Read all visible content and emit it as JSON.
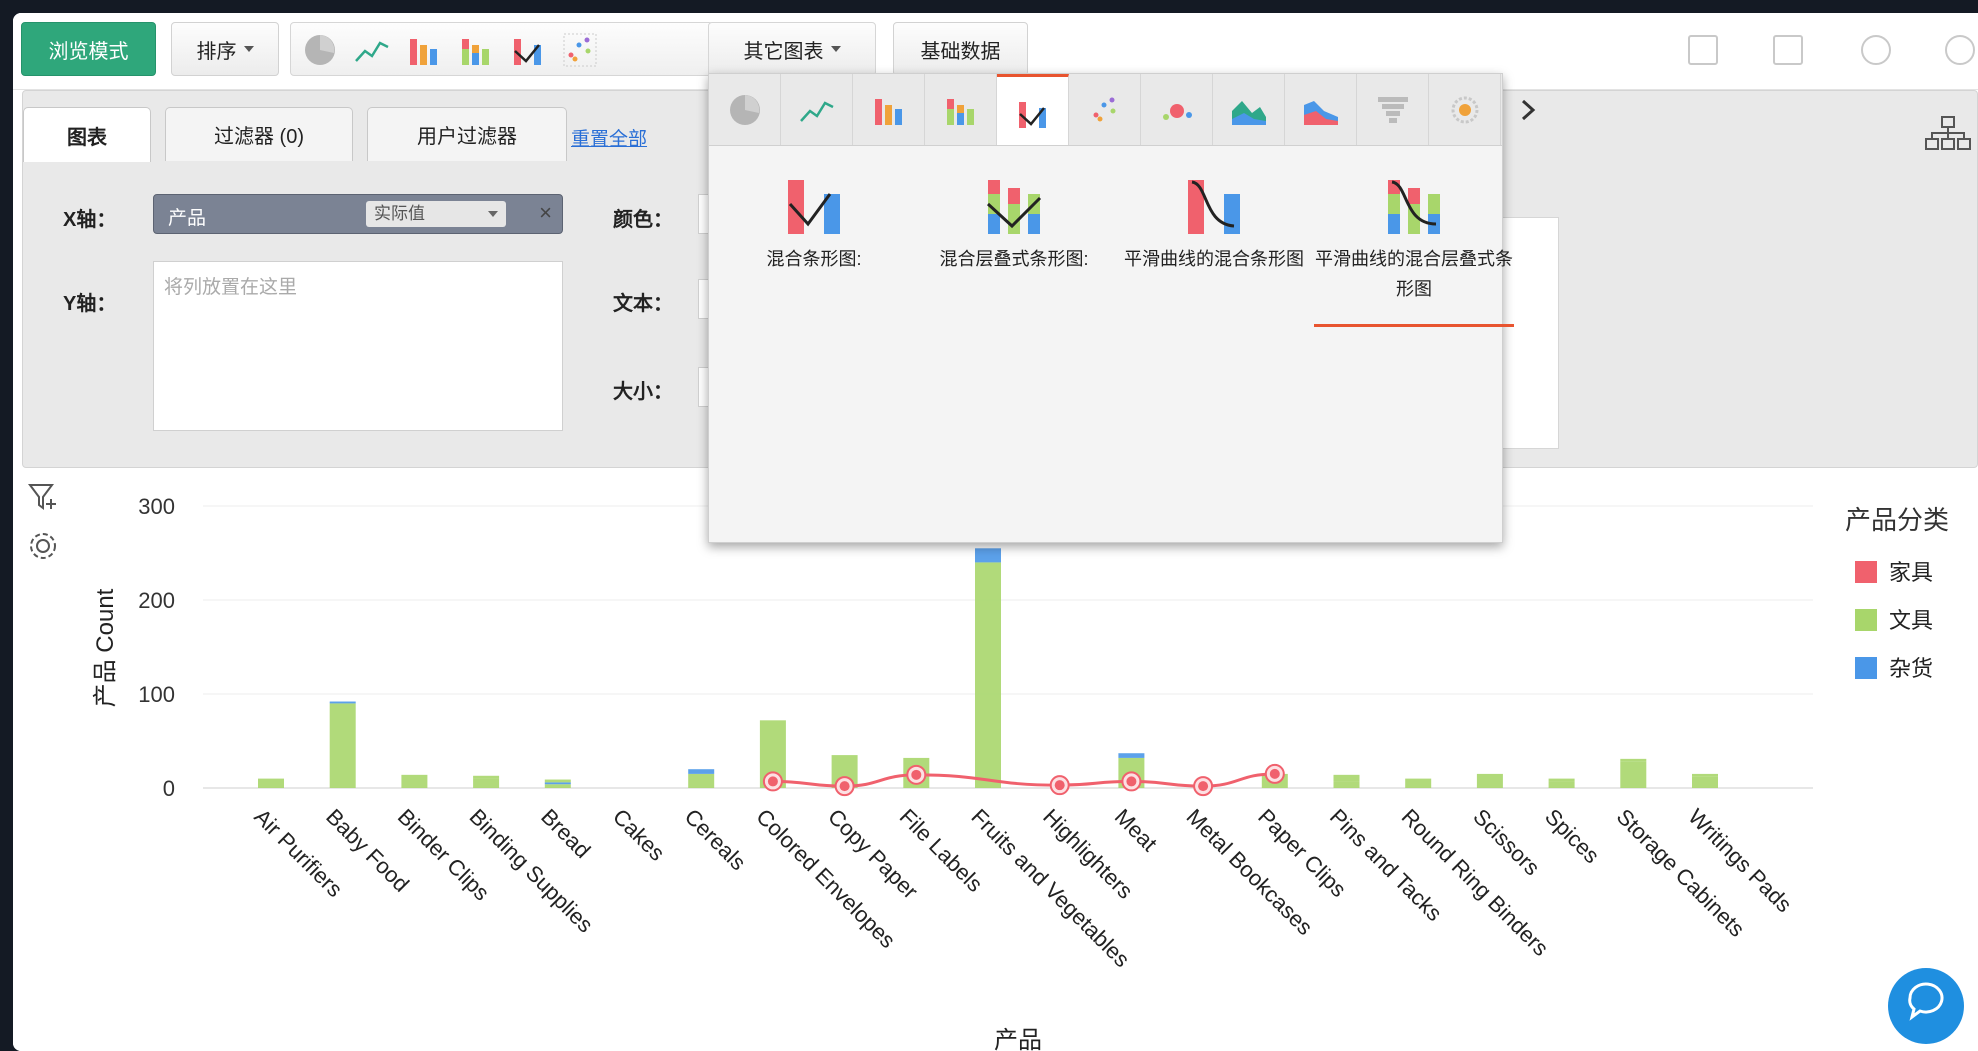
{
  "toolbar": {
    "browse_mode": "浏览模式",
    "sort": "排序",
    "other_charts": "其它图表",
    "base_data": "基础数据"
  },
  "config": {
    "tabs": [
      "图表",
      "过滤器 (0)",
      "用户过滤器"
    ],
    "reset_all": "重置全部",
    "x_axis_label": "X轴：",
    "x_field": "产品",
    "x_aggregation": "实际值",
    "y_axis_label": "Y轴：",
    "y_placeholder": "将列放置在这里",
    "color_label": "颜色：",
    "text_label": "文本：",
    "size_label": "大小："
  },
  "dropdown": {
    "chart_types": [
      "混合条形图:",
      "混合层叠式条形图:",
      "平滑曲线的混合条形图",
      "平滑曲线的混合层叠式条形图"
    ],
    "selected_index": 3
  },
  "legend": {
    "title": "产品分类",
    "items": [
      {
        "label": "家具",
        "color": "#f0616d"
      },
      {
        "label": "文具",
        "color": "#a8d66b"
      },
      {
        "label": "杂货",
        "color": "#4a97e8"
      }
    ]
  },
  "chart_data": {
    "type": "bar",
    "categories": [
      "Air Purifiers",
      "Baby Food",
      "Binder Clips",
      "Binding Supplies",
      "Bread",
      "Cakes",
      "Cereals",
      "Colored Envelopes",
      "Copy Paper",
      "File Labels",
      "Fruits and Vegetables",
      "Highlighters",
      "Meat",
      "Metal Bookcases",
      "Paper Clips",
      "Pins and Tacks",
      "Round Ring Binders",
      "Scissors",
      "Spices",
      "Storage Cabinets",
      "Writings Pads"
    ],
    "xlabel": "产品",
    "ylabel": "产品 Count",
    "ylim": [
      0,
      300
    ],
    "yticks": [
      0,
      100,
      200,
      300
    ],
    "bars": [
      {
        "group": "文具",
        "values": [
          10,
          90,
          14,
          10,
          4,
          0,
          15,
          72,
          35,
          32,
          240,
          0,
          32,
          0,
          15,
          7,
          10,
          15,
          7,
          28,
          12
        ]
      },
      {
        "group": "杂货",
        "values": [
          0,
          2,
          0,
          0,
          2,
          0,
          5,
          0,
          0,
          0,
          15,
          0,
          5,
          0,
          0,
          0,
          0,
          0,
          0,
          0,
          0
        ]
      },
      {
        "group": "文具",
        "values": [
          0,
          0,
          0,
          3,
          3,
          0,
          0,
          0,
          0,
          0,
          0,
          0,
          0,
          0,
          0,
          7,
          0,
          0,
          3,
          3,
          3
        ]
      }
    ],
    "line": {
      "name": "家具",
      "points": [
        {
          "category": "Colored Envelopes",
          "value": 7
        },
        {
          "category": "Copy Paper",
          "value": 2
        },
        {
          "category": "File Labels",
          "value": 14
        },
        {
          "category": "Highlighters",
          "value": 3
        },
        {
          "category": "Meat",
          "value": 7
        },
        {
          "category": "Metal Bookcases",
          "value": 2
        },
        {
          "category": "Paper Clips",
          "value": 15
        }
      ]
    }
  }
}
